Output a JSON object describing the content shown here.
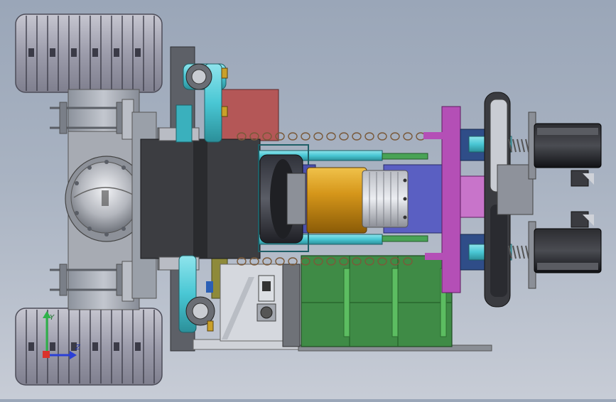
{
  "view": {
    "background_top": "#9aa6b8",
    "background_bottom": "#c7ccd6"
  },
  "model": {
    "parts": [
      "rear-tire-top",
      "rear-tire-bottom",
      "axle-housing",
      "differential-cover",
      "drive-chain",
      "red-mount-block",
      "motor-housing",
      "brass-coupling",
      "gear-hub",
      "blue-bracket",
      "green-battery-box",
      "magenta-plate",
      "brake-disc",
      "servo-motor-top",
      "servo-motor-bottom",
      "base-frame"
    ],
    "colors": {
      "tire": "#a9a9b5",
      "metal": "#9a9fa8",
      "cyan": "#49c7d4",
      "red": "#b85656",
      "green": "#3c8c45",
      "magenta": "#b44fb6",
      "brass": "#d89c20",
      "blue": "#5a5fc2",
      "dark": "#2a2b2e"
    }
  },
  "triad": {
    "axis_y_label": "Y",
    "axis_z_label": "Z",
    "y_color": "#2fb24a",
    "z_color": "#2a3fd6",
    "x_color": "#d9322b"
  }
}
